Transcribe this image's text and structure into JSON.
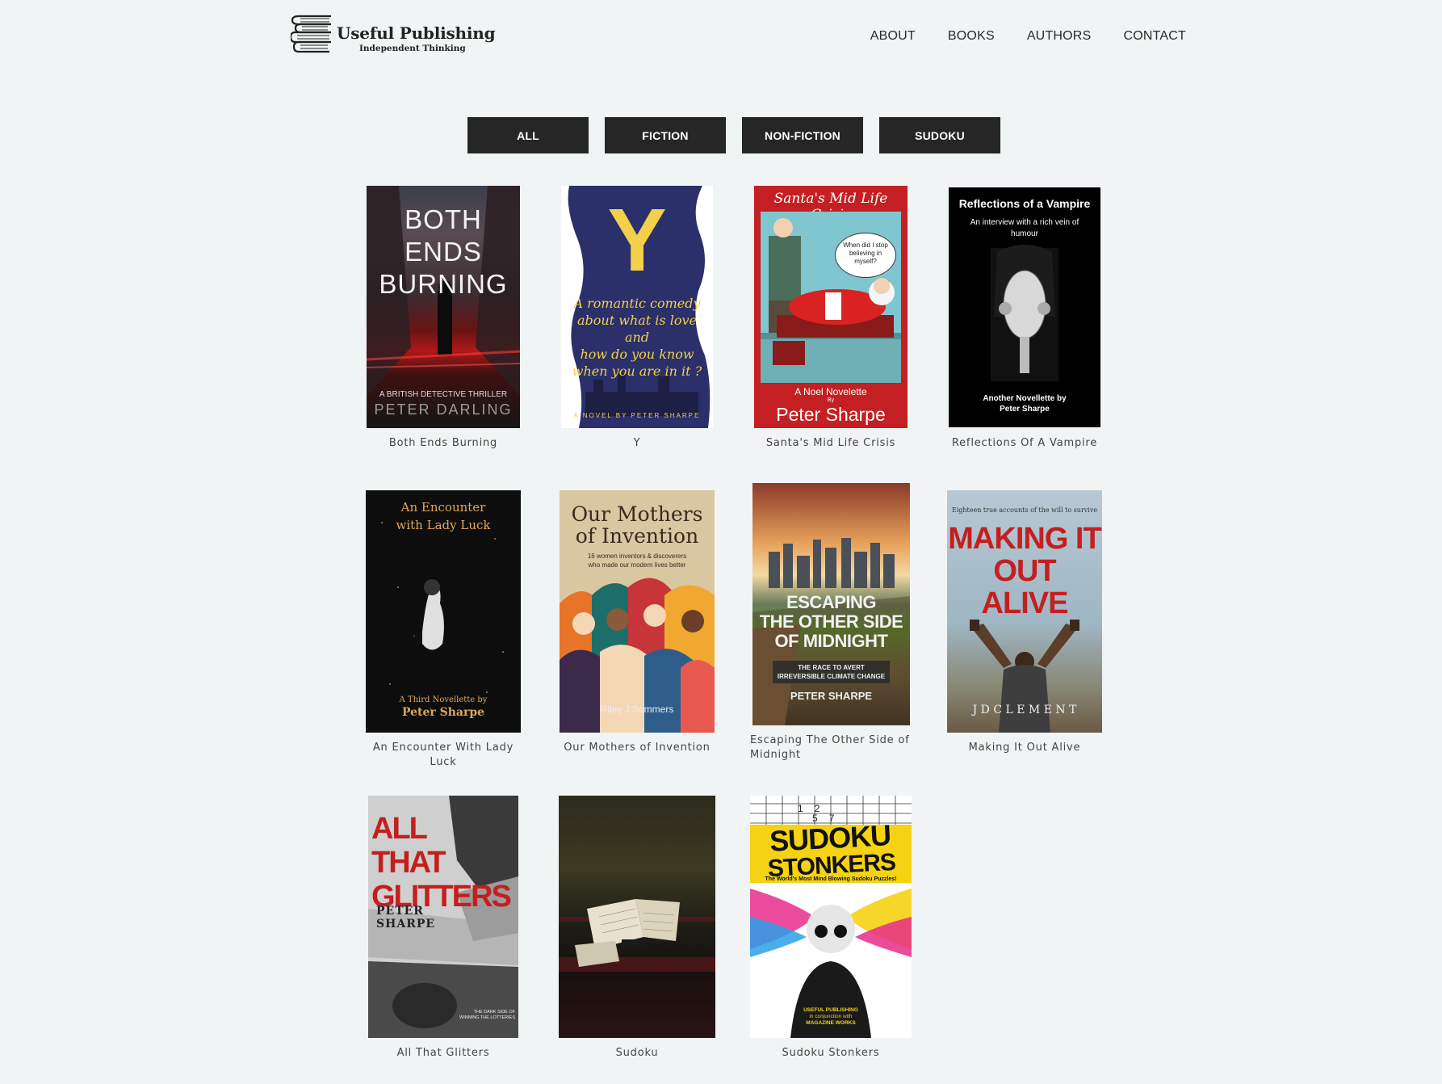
{
  "header": {
    "brand_name": "Useful Publishing",
    "tagline": "Independent Thinking",
    "nav": [
      "ABOUT",
      "BOOKS",
      "AUTHORS",
      "CONTACT"
    ]
  },
  "filters": [
    "ALL",
    "FICTION",
    "NON-FICTION",
    "SUDOKU"
  ],
  "books": [
    {
      "title": "Both Ends Burning",
      "cover": {
        "title_lines": [
          "BOTH",
          "ENDS",
          "BURNING"
        ],
        "subtitle": "A BRITISH DETECTIVE THRILLER",
        "author": "PETER DARLING"
      }
    },
    {
      "title": "Y",
      "cover": {
        "big_letter": "Y",
        "blurb_lines": [
          "A romantic comedy",
          "about what is love",
          "and",
          "how do you know",
          "when you are in it ?"
        ],
        "footer": "A NOVEL BY PETER SHARPE"
      }
    },
    {
      "title": "Santa's Mid Life Crisis",
      "cover": {
        "heading": "Santa's Mid Life Crisis",
        "bubble": "When did I stop believing in myself?",
        "line1": "A Noel Novelette",
        "line2": "By",
        "author": "Peter Sharpe"
      }
    },
    {
      "title": "Reflections Of A Vampire",
      "cover": {
        "heading": "Reflections of a Vampire",
        "subheading": "An interview with a rich vein of humour",
        "footer1": "Another Novellette by",
        "footer2": "Peter Sharpe"
      }
    },
    {
      "title": "An Encounter With Lady Luck",
      "cover": {
        "heading_lines": [
          "An Encounter",
          "with Lady Luck"
        ],
        "footer1": "A Third Novellette by",
        "author": "Peter Sharpe"
      }
    },
    {
      "title": "Our Mothers of Invention",
      "cover": {
        "heading_lines": [
          "Our Mothers",
          "of Invention"
        ],
        "sub_lines": [
          "16 women inventors & discoverers",
          "who made our modern lives better"
        ],
        "author": "Riley J Sommers"
      }
    },
    {
      "title_lines": [
        "Escaping The Other Side of",
        "Midnight"
      ],
      "cover": {
        "heading_lines": [
          "ESCAPING",
          "THE OTHER SIDE",
          "OF MIDNIGHT"
        ],
        "banner_lines": [
          "THE RACE TO AVERT",
          "IRREVERSIBLE CLIMATE CHANGE"
        ],
        "author": "PETER SHARPE"
      }
    },
    {
      "title": "Making It Out Alive",
      "cover": {
        "top": "Eighteen true accounts of the will to survive",
        "heading_lines": [
          "MAKING IT",
          "OUT",
          "ALIVE"
        ],
        "author": "J D C L E M E N T"
      }
    },
    {
      "title": "All That Glitters",
      "cover": {
        "heading_lines": [
          "ALL THAT",
          "GLITTERS"
        ],
        "author_lines": [
          "PETER",
          "SHARPE"
        ],
        "small_lines": [
          "THE DARK SIDE OF",
          "WINNING THE LOTTERIES"
        ]
      }
    },
    {
      "title": "Sudoku",
      "cover": {}
    },
    {
      "title": "Sudoku Stonkers",
      "cover": {
        "heading_lines": [
          "SUDOKU",
          "STONKERS"
        ],
        "tag": "The World's Most Mind Blowing Sudoku Puzzles!",
        "grid_digits": [
          "1",
          "2",
          "5",
          "7"
        ],
        "shirt_lines": [
          "USEFUL PUBLISHING",
          "in conjunction with",
          "MAGAZINE WORKS"
        ]
      }
    }
  ]
}
